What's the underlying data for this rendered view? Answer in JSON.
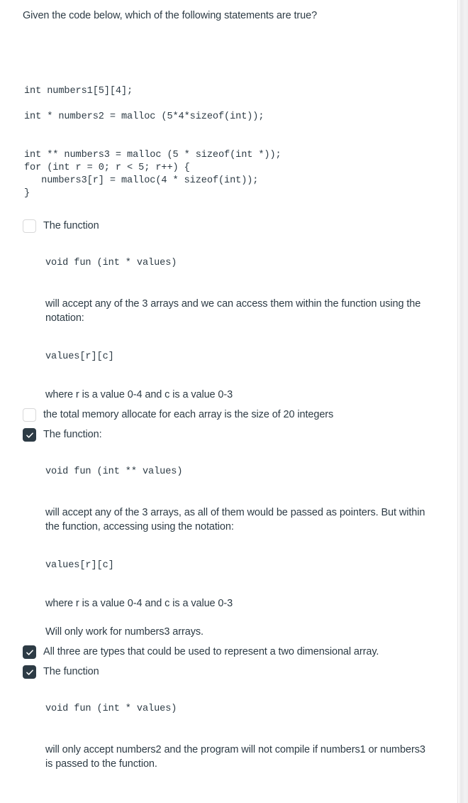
{
  "question": {
    "prompt": "Given the code below, which of the following statements are true?",
    "code": "int numbers1[5][4];\n\nint * numbers2 = malloc (5*4*sizeof(int));",
    "code_block_1": "int numbers1[5][4];",
    "code_block_2": "int * numbers2 = malloc (5*4*sizeof(int));",
    "code_block_3": "int ** numbers3 = malloc (5 * sizeof(int *));\nfor (int r = 0; r < 5; r++) {\n   numbers3[r] = malloc(4 * sizeof(int));\n}"
  },
  "answers": [
    {
      "id": "answer-1",
      "checked": false,
      "label": "The function",
      "body": {
        "signature": "void fun (int * values)",
        "paragraph_1": "will accept any of the 3 arrays and we can access them within the function using the notation:",
        "notation": "values[r][c]",
        "paragraph_2": "where r is a value 0-4 and c is a value 0-3"
      }
    },
    {
      "id": "answer-2",
      "checked": false,
      "label": "the total memory allocate for each array is the size of 20 integers",
      "body": null
    },
    {
      "id": "answer-3",
      "checked": true,
      "label": "The function:",
      "body": {
        "signature": "void fun (int ** values)",
        "paragraph_1": "will accept any of the 3 arrays, as all of them would be passed as pointers.  But within the function, accessing using the notation:",
        "notation": "values[r][c]",
        "paragraph_2": "where r is a value 0-4 and c is a value 0-3",
        "paragraph_3": "Will only work for numbers3 arrays."
      }
    },
    {
      "id": "answer-4",
      "checked": true,
      "label": "All three are types that could be used to represent a two dimensional array.",
      "body": null
    },
    {
      "id": "answer-5",
      "checked": true,
      "label": "The function",
      "body": {
        "signature": "void fun (int * values)",
        "paragraph_1": "will only accept numbers2 and the program will not compile if numbers1 or numbers3 is passed to the function."
      }
    }
  ],
  "colors": {
    "text": "#2d3b45",
    "checkbox_checked_bg": "#2d3b45",
    "checkbox_unchecked_border": "#d8d8d9",
    "page_bg": "#ffffff"
  }
}
